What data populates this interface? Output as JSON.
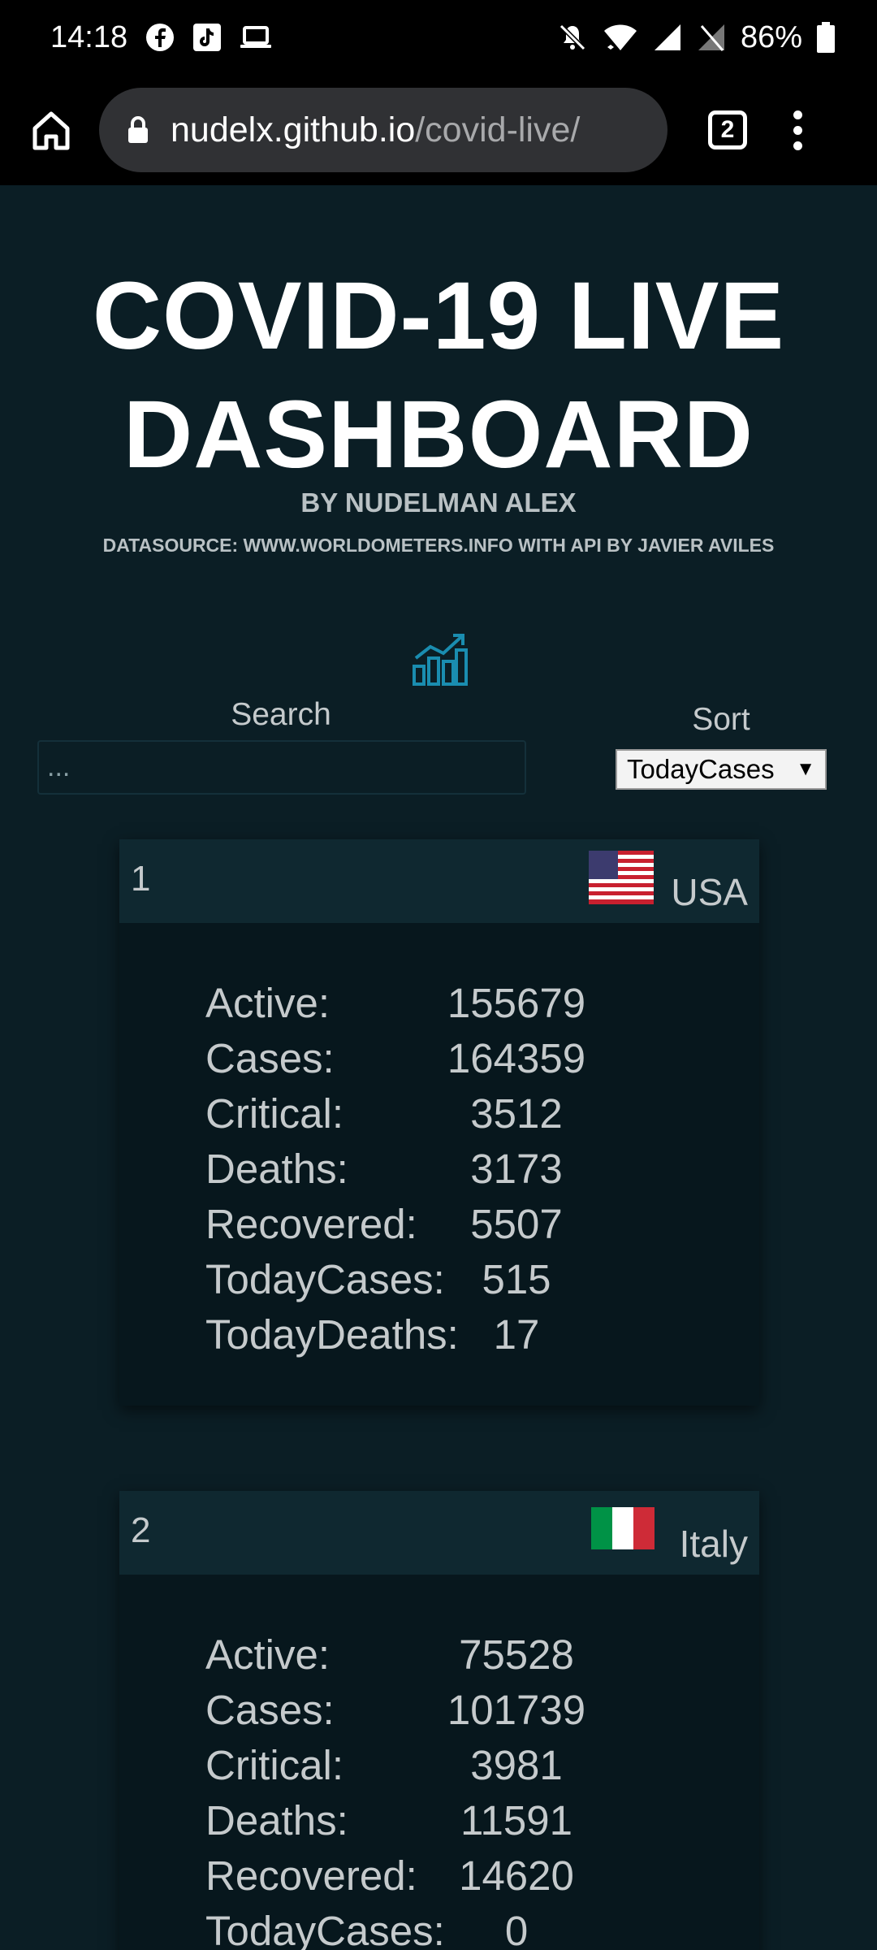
{
  "status_bar": {
    "time": "14:18",
    "left_icons": [
      "facebook-icon",
      "tiktok-icon",
      "laptop-icon"
    ],
    "battery": "86%"
  },
  "browser": {
    "url_host": "nudelx.github.io",
    "url_path": "/covid-live/",
    "tab_count": "2"
  },
  "header": {
    "title_line1": "COVID-19 LIVE",
    "title_line2": "DASHBOARD",
    "subtitle": "BY NUDELMAN ALEX",
    "datasource": "DATASOURCE: WWW.WORLDOMETERS.INFO WITH API BY JAVIER AVILES"
  },
  "controls": {
    "search_label": "Search",
    "search_placeholder": "...",
    "sort_label": "Sort",
    "sort_value": "TodayCases",
    "sort_arrow": "▼"
  },
  "cards": [
    {
      "rank": "1",
      "country": "USA",
      "stats": [
        {
          "label": "Active:",
          "value": "155679"
        },
        {
          "label": "Cases:",
          "value": "164359"
        },
        {
          "label": "Critical:",
          "value": "3512"
        },
        {
          "label": "Deaths:",
          "value": "3173"
        },
        {
          "label": "Recovered:",
          "value": "5507"
        },
        {
          "label": "TodayCases:",
          "value": "515"
        },
        {
          "label": "TodayDeaths:",
          "value": "17"
        }
      ]
    },
    {
      "rank": "2",
      "country": "Italy",
      "stats": [
        {
          "label": "Active:",
          "value": "75528"
        },
        {
          "label": "Cases:",
          "value": "101739"
        },
        {
          "label": "Critical:",
          "value": "3981"
        },
        {
          "label": "Deaths:",
          "value": "11591"
        },
        {
          "label": "Recovered:",
          "value": "14620"
        },
        {
          "label": "TodayCases:",
          "value": "0"
        }
      ]
    }
  ],
  "colors": {
    "background": "#0b1e25",
    "card": "#07171d",
    "card_header": "#0f2830",
    "accent_icon": "#1a8db0"
  }
}
